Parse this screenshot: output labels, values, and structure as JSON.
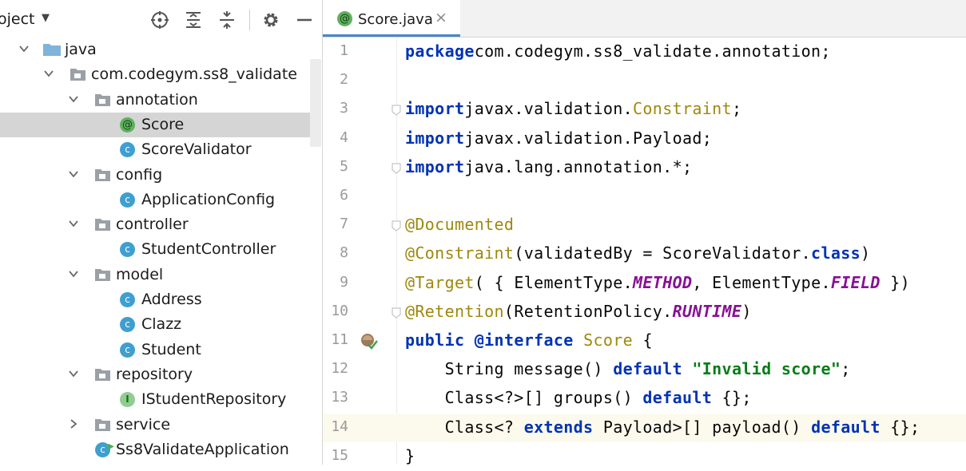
{
  "project_panel": {
    "title": "oject",
    "toolbar_icons": [
      "locate-icon",
      "expand-all-icon",
      "collapse-all-icon",
      "gear-icon",
      "minimize-icon"
    ],
    "tree": [
      {
        "label": "java",
        "type": "folder-blue",
        "depth": 0,
        "arrow": "down"
      },
      {
        "label": "com.codegym.ss8_validate",
        "type": "package",
        "depth": 1,
        "arrow": "down"
      },
      {
        "label": "annotation",
        "type": "package",
        "depth": 2,
        "arrow": "down"
      },
      {
        "label": "Score",
        "type": "annotation",
        "depth": 3,
        "arrow": "",
        "selected": true
      },
      {
        "label": "ScoreValidator",
        "type": "class",
        "depth": 3,
        "arrow": ""
      },
      {
        "label": "config",
        "type": "package",
        "depth": 2,
        "arrow": "down"
      },
      {
        "label": "ApplicationConfig",
        "type": "class",
        "depth": 3,
        "arrow": ""
      },
      {
        "label": "controller",
        "type": "package",
        "depth": 2,
        "arrow": "down"
      },
      {
        "label": "StudentController",
        "type": "class",
        "depth": 3,
        "arrow": ""
      },
      {
        "label": "model",
        "type": "package",
        "depth": 2,
        "arrow": "down"
      },
      {
        "label": "Address",
        "type": "class",
        "depth": 3,
        "arrow": ""
      },
      {
        "label": "Clazz",
        "type": "class",
        "depth": 3,
        "arrow": ""
      },
      {
        "label": "Student",
        "type": "class",
        "depth": 3,
        "arrow": ""
      },
      {
        "label": "repository",
        "type": "package",
        "depth": 2,
        "arrow": "down"
      },
      {
        "label": "IStudentRepository",
        "type": "interface",
        "depth": 3,
        "arrow": ""
      },
      {
        "label": "service",
        "type": "package",
        "depth": 2,
        "arrow": "right"
      },
      {
        "label": "Ss8ValidateApplication",
        "type": "app-class",
        "depth": 2,
        "arrow": ""
      }
    ]
  },
  "editor": {
    "tab": {
      "label": "Score.java",
      "icon": "annotation-icon",
      "close": "×"
    },
    "current_line": 14,
    "lines": [
      {
        "n": "1",
        "tokens": [
          [
            "kw",
            "package"
          ],
          [
            "",
            "com.codegym.ss8_validate.annotation;"
          ]
        ]
      },
      {
        "n": "2",
        "tokens": []
      },
      {
        "n": "3",
        "fold": true,
        "tokens": [
          [
            "kw",
            "import"
          ],
          [
            "",
            "javax.validation."
          ],
          [
            "ann",
            "Constraint"
          ],
          [
            "",
            ";"
          ]
        ]
      },
      {
        "n": "4",
        "tokens": [
          [
            "kw",
            "import"
          ],
          [
            "",
            "javax.validation.Payload;"
          ]
        ]
      },
      {
        "n": "5",
        "fold": true,
        "tokens": [
          [
            "kw",
            "import"
          ],
          [
            "",
            "java.lang.annotation.*;"
          ]
        ]
      },
      {
        "n": "6",
        "tokens": []
      },
      {
        "n": "7",
        "fold": true,
        "tokens": [
          [
            "ann",
            "@Documented"
          ]
        ]
      },
      {
        "n": "8",
        "tokens": [
          [
            "ann",
            "@Constraint"
          ],
          [
            "",
            "(validatedBy = ScoreValidator."
          ],
          [
            "kw",
            "class"
          ],
          [
            "",
            ")"
          ]
        ]
      },
      {
        "n": "9",
        "tokens": [
          [
            "ann",
            "@Target"
          ],
          [
            "",
            "( { ElementType."
          ],
          [
            "const",
            "METHOD"
          ],
          [
            "",
            ", ElementType."
          ],
          [
            "const",
            "FIELD"
          ],
          [
            "",
            " })"
          ]
        ]
      },
      {
        "n": "10",
        "fold": true,
        "tokens": [
          [
            "ann",
            "@Retention"
          ],
          [
            "",
            "(RetentionPolicy."
          ],
          [
            "const",
            "RUNTIME"
          ],
          [
            "",
            ")"
          ]
        ]
      },
      {
        "n": "11",
        "marker": true,
        "tokens": [
          [
            "kw",
            "public"
          ],
          [
            "",
            " "
          ],
          [
            "kw",
            "@interface"
          ],
          [
            "",
            " "
          ],
          [
            "iface",
            "Score"
          ],
          [
            "",
            " {"
          ]
        ]
      },
      {
        "n": "12",
        "tokens": [
          [
            "",
            "    String message() "
          ],
          [
            "kw",
            "default"
          ],
          [
            "",
            " "
          ],
          [
            "str",
            "\"Invalid score\""
          ],
          [
            "",
            ";"
          ]
        ]
      },
      {
        "n": "13",
        "tokens": [
          [
            "",
            "    Class<?>[] groups() "
          ],
          [
            "kw",
            "default"
          ],
          [
            "",
            " {};"
          ]
        ]
      },
      {
        "n": "14",
        "tokens": [
          [
            "",
            "    Class<? "
          ],
          [
            "kw",
            "extends"
          ],
          [
            "",
            " Payload>[] payload() "
          ],
          [
            "kw",
            "default"
          ],
          [
            "",
            " {};"
          ]
        ]
      },
      {
        "n": "15",
        "tokens": [
          [
            "",
            "}"
          ]
        ]
      }
    ]
  },
  "colors": {
    "keyword": "#0033b3",
    "annotation": "#9e880d",
    "string": "#067d17",
    "constant": "#871094",
    "selection": "#d5d5d5",
    "current_line": "#fcfaed",
    "tab_underline": "#4a86c8"
  }
}
